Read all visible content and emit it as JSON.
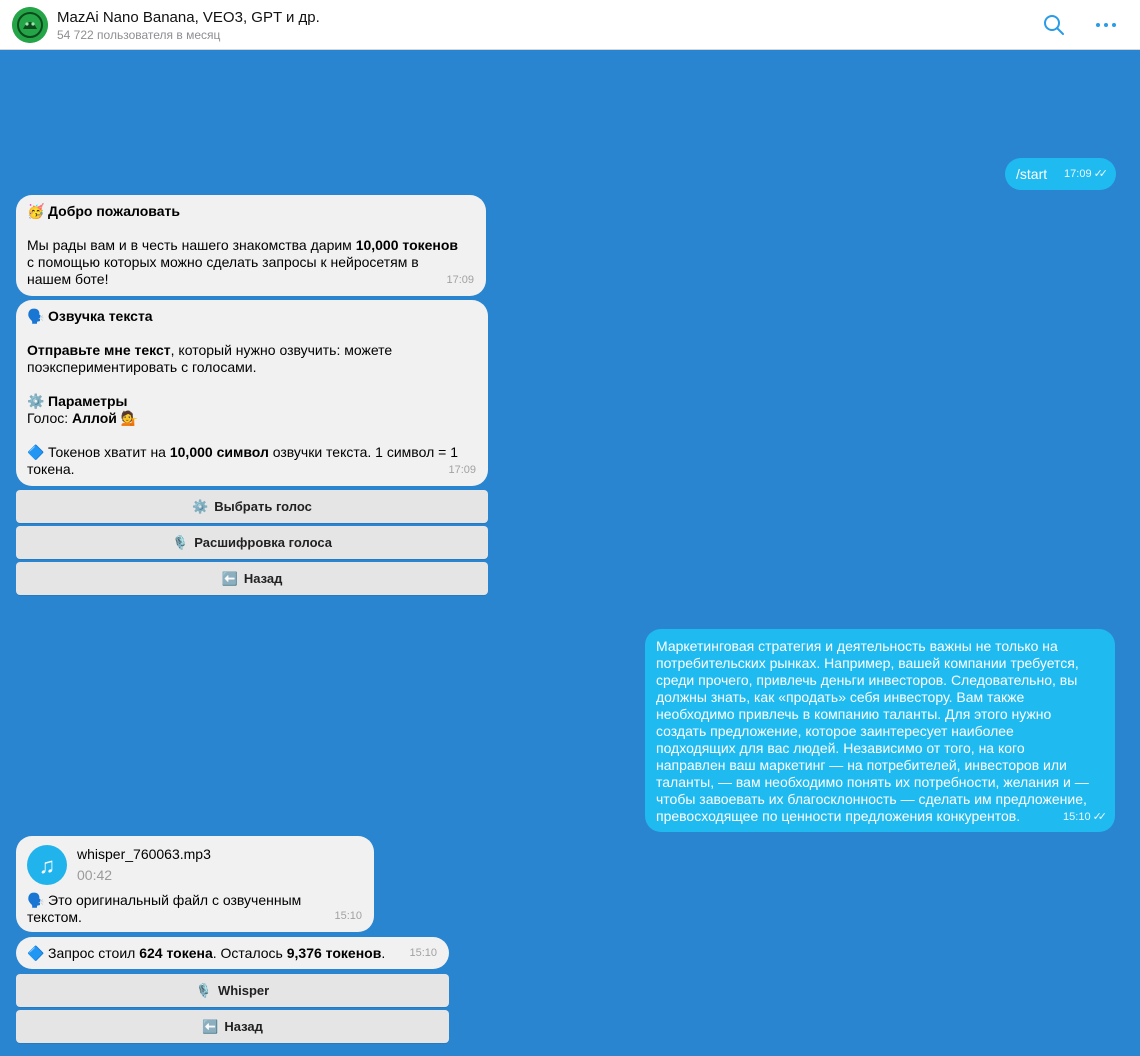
{
  "header": {
    "title": "MazAi Nano Banana, VEO3, GPT и др.",
    "subtitle": "54 722 пользователя в месяц"
  },
  "messages": {
    "start": {
      "text": "/start",
      "time": "17:09"
    },
    "welcome": {
      "icon": "🥳",
      "title": "Добро пожаловать",
      "line1_pre": "Мы рады вам и в честь нашего знакомства дарим ",
      "line1_bold": "10,000 токенов",
      "line2": "с помощью которых можно сделать запросы к нейросетям в",
      "line3": "нашем боте!",
      "time": "17:09"
    },
    "tts": {
      "icon": "🗣️",
      "title": "Озвучка текста",
      "p1_bold": "Отправьте мне текст",
      "p1_rest": ", который нужно озвучить: можете",
      "p1_line2": "поэкспериментировать с голосами.",
      "params_icon": "⚙️",
      "params_title": "Параметры",
      "voice_label": "Голос: ",
      "voice_value": "Аллой",
      "voice_emoji": "💁",
      "tokens_icon": "🔷",
      "tokens_pre": "Токенов хватит на ",
      "tokens_bold": "10,000 символ",
      "tokens_rest": " озвучки текста. 1 символ = 1",
      "tokens_line2": "токена.",
      "time": "17:09"
    },
    "user_text": {
      "lines": [
        "Маркетинговая стратегия и деятельность важны не только на",
        "потребительских рынках. Например, вашей компании требуется,",
        "среди прочего, привлечь деньги инвесторов. Следовательно, вы",
        "должны знать, как «продать» себя инвестору. Вам также",
        "необходимо привлечь в компанию таланты. Для этого нужно",
        "создать предложение, которое заинтересует наиболее",
        "подходящих для вас людей. Независимо от того, на кого",
        "направлен ваш маркетинг — на потребителей, инвесторов или",
        "таланты, — вам необходимо понять их потребности, желания и —",
        "чтобы завоевать их благосклонность — сделать им предложение,",
        "превосходящее по ценности предложения конкурентов."
      ],
      "time": "15:10"
    },
    "audio": {
      "filename": "whisper_760063.mp3",
      "duration": "00:42",
      "icon": "🗣️",
      "caption_line1": "Это оригинальный файл с озвученным",
      "caption_line2": "текстом.",
      "time": "15:10"
    },
    "cost": {
      "icon": "🔷",
      "pre": "Запрос стоил ",
      "bold1": "624 токена",
      "mid": ". Осталось ",
      "bold2": "9,376 токенов",
      "end": ".",
      "time": "15:10"
    }
  },
  "keyboard1": {
    "choose_voice": {
      "icon": "⚙️",
      "label": "Выбрать голос"
    },
    "transcribe": {
      "icon": "🎙️",
      "label": "Расшифровка голоса"
    },
    "back": {
      "icon": "⬅️",
      "label": "Назад"
    }
  },
  "keyboard2": {
    "whisper": {
      "icon": "🎙️",
      "label": "Whisper"
    },
    "back": {
      "icon": "⬅️",
      "label": "Назад"
    }
  },
  "colors": {
    "background": "#2a85d0",
    "incoming_bubble": "#f1f1f1",
    "outgoing_bubble": "#1fbaf0",
    "accent": "#1a9be8"
  },
  "icons": {
    "search": "search-icon",
    "more": "more-dots-icon",
    "music": "music-note-icon",
    "read_ticks": "double-check-icon"
  }
}
